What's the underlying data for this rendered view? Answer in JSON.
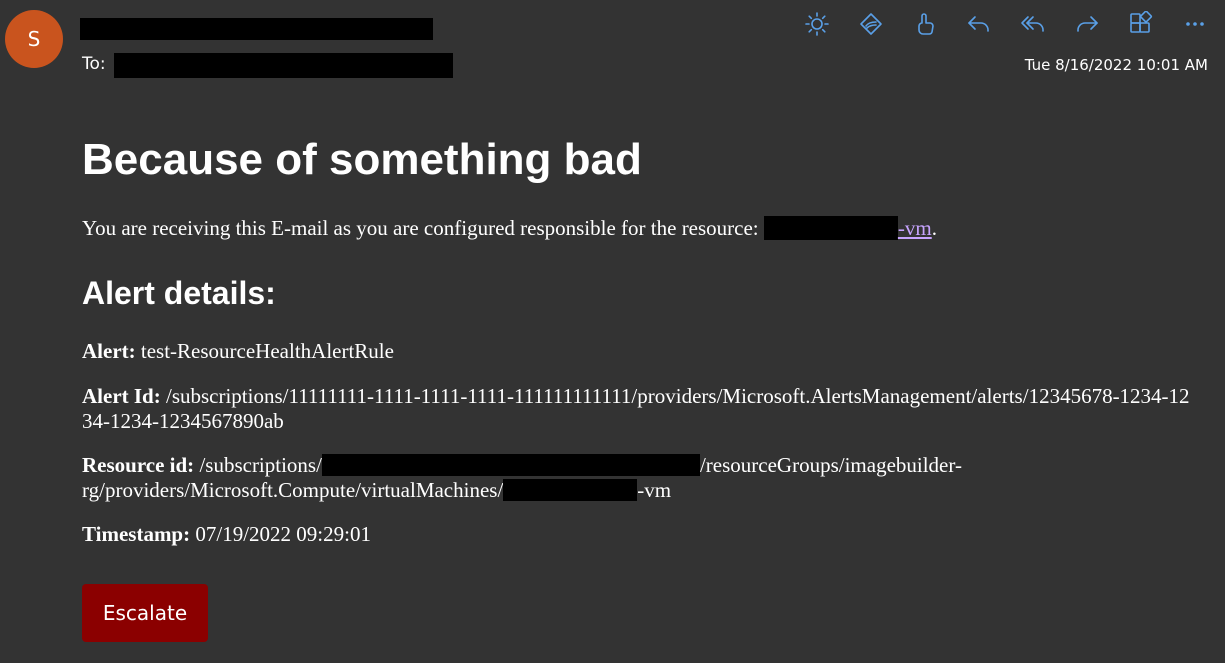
{
  "header": {
    "avatar_initial": "S",
    "avatar_color": "#c9541e",
    "to_label": "To:",
    "date": "Tue 8/16/2022 10:01 AM"
  },
  "toolbar": {
    "icon_color": "#5aa0e8",
    "icons": [
      "sun-icon",
      "immersive-reader-icon",
      "like-icon",
      "reply-icon",
      "reply-all-icon",
      "forward-icon",
      "apps-icon",
      "more-icon"
    ]
  },
  "body": {
    "headline": "Because of something bad",
    "intro_prefix": "You are receiving this E-mail as you are configured responsible for the resource: ",
    "intro_link": "-vm",
    "intro_suffix": ".",
    "link_color": "#c7a4ff",
    "alert_heading": "Alert details:",
    "alert_label": "Alert:",
    "alert_value": "test-ResourceHealthAlertRule",
    "alert_id_label": "Alert Id:",
    "alert_id_value": "/subscriptions/11111111-1111-1111-1111-111111111111/providers/Microsoft.AlertsManagement/alerts/12345678-1234-1234-1234-1234567890ab",
    "resource_label": "Resource id:",
    "resource_part1": "/subscriptions/",
    "resource_part2": "/resourceGroups/imagebuilder-rg/providers/Microsoft.Compute/virtualMachines/",
    "resource_part3": "-vm",
    "timestamp_label": "Timestamp:",
    "timestamp_value": "07/19/2022 09:29:01",
    "escalate_label": "Escalate",
    "escalate_color": "#8b0000"
  }
}
